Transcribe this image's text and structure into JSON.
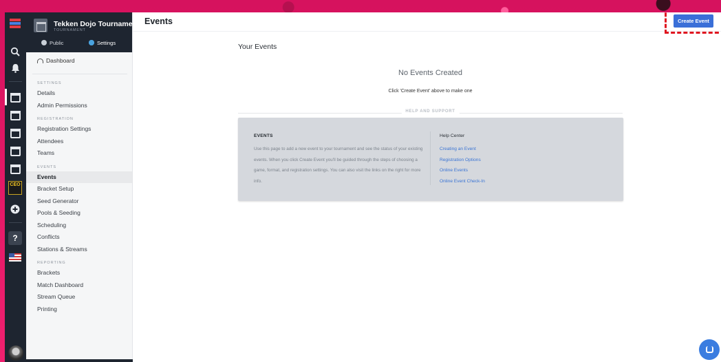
{
  "tournament": {
    "name": "Tekken Dojo Tournament",
    "type_label": "TOURNAMENT",
    "public_label": "Public",
    "settings_label": "Settings"
  },
  "nav": {
    "dashboard": "Dashboard",
    "sections": [
      {
        "title": "SETTINGS",
        "items": [
          "Details",
          "Admin Permissions"
        ]
      },
      {
        "title": "REGISTRATION",
        "items": [
          "Registration Settings",
          "Attendees",
          "Teams"
        ]
      },
      {
        "title": "EVENTS",
        "items": [
          "Events",
          "Bracket Setup",
          "Seed Generator",
          "Pools & Seeding",
          "Scheduling",
          "Conflicts",
          "Stations & Streams"
        ]
      },
      {
        "title": "REPORTING",
        "items": [
          "Brackets",
          "Match Dashboard",
          "Stream Queue",
          "Printing"
        ]
      }
    ],
    "active_item": "Events"
  },
  "rail": {
    "icons": [
      "brand-logo-icon",
      "search-icon",
      "bell-icon",
      "calendar-icon",
      "calendar-icon",
      "calendar-icon",
      "calendar-icon",
      "calendar-icon",
      "ceo-badge-icon",
      "add-circle-icon",
      "help-icon",
      "us-flag-icon",
      "user-avatar-icon"
    ],
    "ceo_text": "CEO"
  },
  "header": {
    "title": "Events",
    "create_button": "Create Event"
  },
  "main": {
    "your_events": "Your Events",
    "empty_title": "No Events Created",
    "empty_hint": "Click 'Create Event' above to make one",
    "help_divider": "HELP AND SUPPORT"
  },
  "help": {
    "heading": "EVENTS",
    "body": "Use this page to add a new event to your tournament and see the status of your existing events. When you click Create Event you'll be guided through the steps of choosing a game, format, and registration settings. You can also visit the links on the right for more info.",
    "center_title": "Help Center",
    "links": [
      "Creating an Event",
      "Registration Options",
      "Online Events",
      "Online Event Check-In"
    ]
  },
  "colors": {
    "accent": "#3a6fd8",
    "rail_bg": "#1e2530",
    "highlight": "#e0141f",
    "background": "#e8186a"
  }
}
